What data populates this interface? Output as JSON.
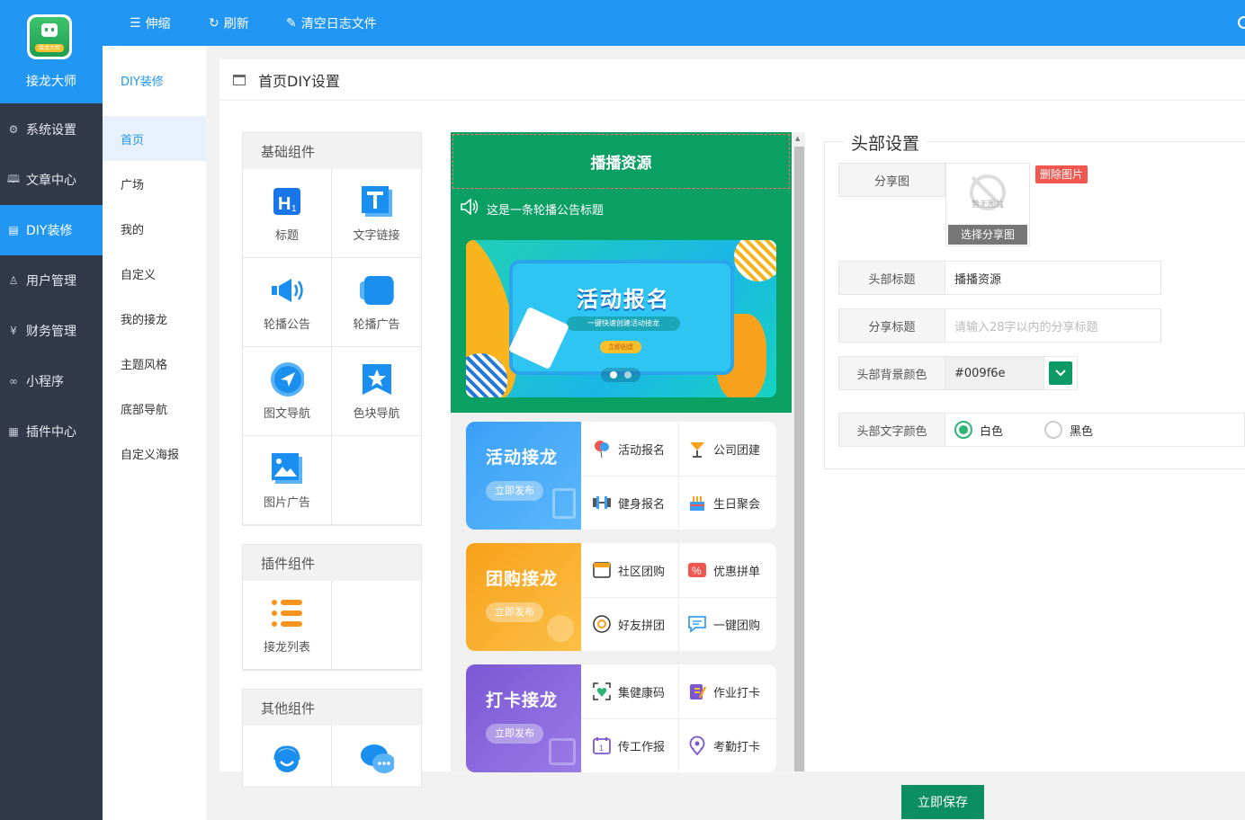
{
  "brand": {
    "name": "接龙大师",
    "logo_tag": "接龙大师"
  },
  "sidebar": {
    "items": [
      {
        "label": "系统设置",
        "icon": "gear-icon"
      },
      {
        "label": "文章中心",
        "icon": "book-icon"
      },
      {
        "label": "DIY装修",
        "icon": "layout-icon",
        "active": true
      },
      {
        "label": "用户管理",
        "icon": "user-icon"
      },
      {
        "label": "财务管理",
        "icon": "yen-icon"
      },
      {
        "label": "小程序",
        "icon": "link-icon"
      },
      {
        "label": "插件中心",
        "icon": "grid-icon"
      }
    ]
  },
  "toolbar": {
    "collapse": "伸缩",
    "refresh": "刷新",
    "clear_logs": "清空日志文件"
  },
  "subnav": {
    "title": "DIY装修",
    "items": [
      "首页",
      "广场",
      "我的",
      "自定义",
      "我的接龙",
      "主题风格",
      "底部导航",
      "自定义海报"
    ],
    "active": "首页"
  },
  "main": {
    "title": "首页DIY设置"
  },
  "components": {
    "basic": {
      "title": "基础组件",
      "items": [
        "标题",
        "文字链接",
        "轮播公告",
        "轮播广告",
        "图文导航",
        "色块导航",
        "图片广告"
      ]
    },
    "plugin": {
      "title": "插件组件",
      "items": [
        "接龙列表"
      ]
    },
    "other": {
      "title": "其他组件"
    }
  },
  "preview": {
    "header_title": "播播资源",
    "notice": "这是一条轮播公告标题",
    "banner": {
      "title": "活动报名",
      "subtitle": "一键快速创建活动接龙",
      "button": "立即创建"
    },
    "cards": [
      {
        "title": "活动接龙",
        "button": "立即发布",
        "color": "#3aa0f7",
        "items": [
          "活动报名",
          "公司团建",
          "健身报名",
          "生日聚会"
        ]
      },
      {
        "title": "团购接龙",
        "button": "立即发布",
        "color": "#f7a11c",
        "items": [
          "社区团购",
          "优惠拼单",
          "好友拼团",
          "一键团购"
        ]
      },
      {
        "title": "打卡接龙",
        "button": "立即发布",
        "color": "#7b57d4",
        "items": [
          "集健康码",
          "作业打卡",
          "传工作报",
          "考勤打卡"
        ]
      }
    ]
  },
  "settings": {
    "legend": "头部设置",
    "share_image_label": "分享图",
    "delete_image": "删除图片",
    "no_image": "暂无图片",
    "choose_image": "选择分享图",
    "header_title_label": "头部标题",
    "header_title_value": "播播资源",
    "share_title_label": "分享标题",
    "share_title_placeholder": "请输入28字以内的分享标题",
    "bg_color_label": "头部背景颜色",
    "bg_color_value": "#009f6e",
    "text_color_label": "头部文字颜色",
    "text_color_options": [
      "白色",
      "黑色"
    ],
    "text_color_selected": "白色"
  },
  "save_button": "立即保存"
}
